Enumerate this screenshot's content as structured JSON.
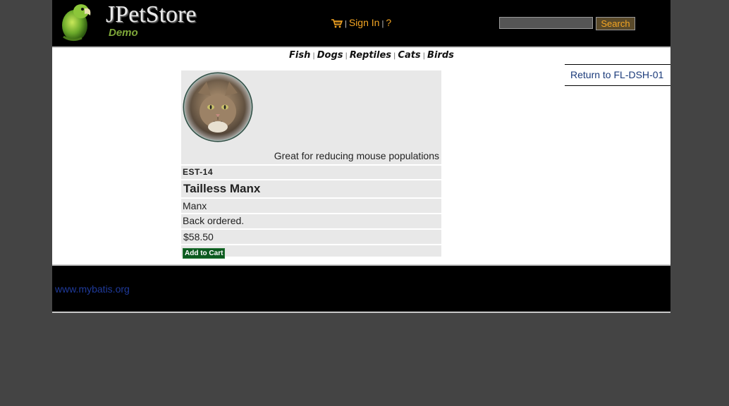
{
  "header": {
    "logo_title": "JPetStore",
    "logo_subtitle": "Demo",
    "cart_icon": "shopping-cart-icon",
    "sign_in_label": "Sign In",
    "help_label": "?",
    "separator": "|"
  },
  "search": {
    "value": "",
    "button_label": "Search"
  },
  "quicklinks": [
    "Fish",
    "Dogs",
    "Reptiles",
    "Cats",
    "Birds"
  ],
  "back_link": "Return to FL-DSH-01",
  "item": {
    "description": "Great for reducing mouse populations",
    "id": "EST-14",
    "name": "Tailless Manx",
    "attribute": "Manx",
    "stock": "Back ordered.",
    "price": "$58.50",
    "add_to_cart": "Add to Cart",
    "photo_icon": "cat-photo"
  },
  "footer": {
    "link": "www.mybatis.org"
  },
  "colors": {
    "page_bg": "#444444",
    "header_bg": "#000000",
    "accent_link": "#f5a623",
    "row_bg": "#e8e8e8",
    "cart_button": "#0b5a1f"
  }
}
